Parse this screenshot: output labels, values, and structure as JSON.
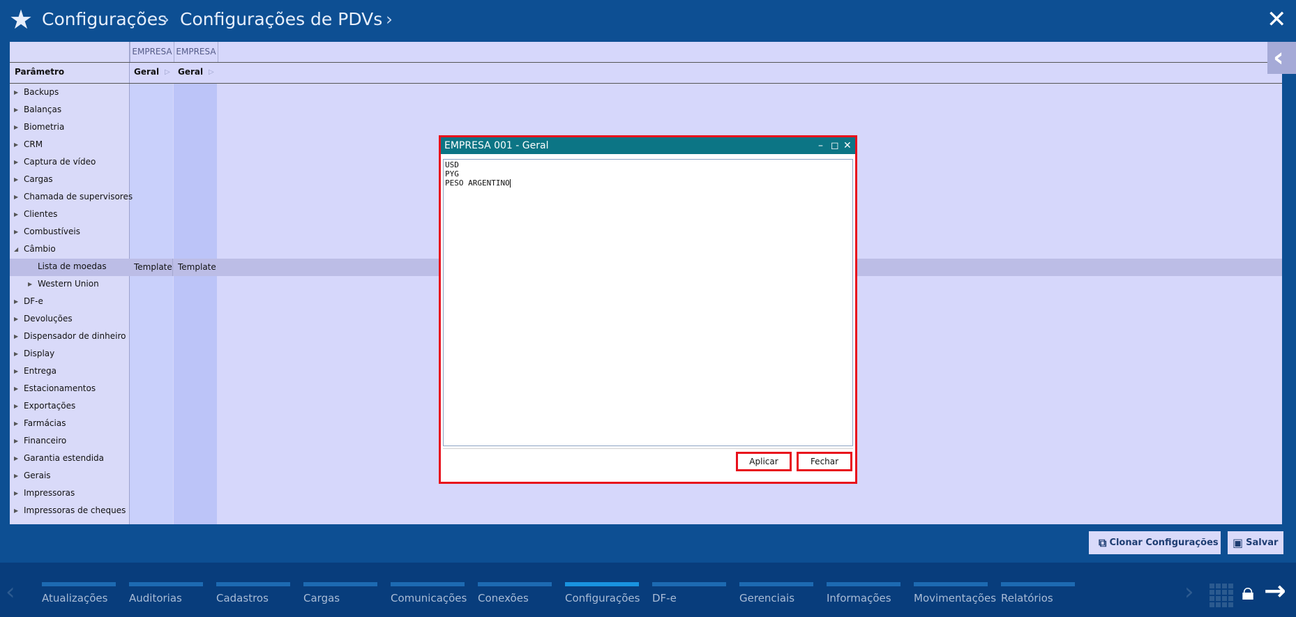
{
  "header": {
    "breadcrumb_1": "Configurações",
    "breadcrumb_2": "Configurações de PDVs"
  },
  "grid": {
    "column_group_1": "EMPRESA",
    "column_group_2": "EMPRESA",
    "param_header": "Parâmetro",
    "col_1_label": "Geral",
    "col_2_label": "Geral",
    "selected_row_values": [
      "Template",
      "Template"
    ]
  },
  "tree": [
    {
      "label": "Backups",
      "level": 0,
      "expanded": false
    },
    {
      "label": "Balanças",
      "level": 0,
      "expanded": false
    },
    {
      "label": "Biometria",
      "level": 0,
      "expanded": false
    },
    {
      "label": "CRM",
      "level": 0,
      "expanded": false
    },
    {
      "label": "Captura de vídeo",
      "level": 0,
      "expanded": false
    },
    {
      "label": "Cargas",
      "level": 0,
      "expanded": false
    },
    {
      "label": "Chamada de supervisores",
      "level": 0,
      "expanded": false
    },
    {
      "label": "Clientes",
      "level": 0,
      "expanded": false
    },
    {
      "label": "Combustíveis",
      "level": 0,
      "expanded": false
    },
    {
      "label": "Câmbio",
      "level": 0,
      "expanded": true
    },
    {
      "label": "Lista de moedas",
      "level": 1,
      "leaf": true
    },
    {
      "label": "Western Union",
      "level": 1,
      "expanded": false
    },
    {
      "label": "DF-e",
      "level": 0,
      "expanded": false
    },
    {
      "label": "Devoluções",
      "level": 0,
      "expanded": false
    },
    {
      "label": "Dispensador de dinheiro",
      "level": 0,
      "expanded": false
    },
    {
      "label": "Display",
      "level": 0,
      "expanded": false
    },
    {
      "label": "Entrega",
      "level": 0,
      "expanded": false
    },
    {
      "label": "Estacionamentos",
      "level": 0,
      "expanded": false
    },
    {
      "label": "Exportações",
      "level": 0,
      "expanded": false
    },
    {
      "label": "Farmácias",
      "level": 0,
      "expanded": false
    },
    {
      "label": "Financeiro",
      "level": 0,
      "expanded": false
    },
    {
      "label": "Garantia estendida",
      "level": 0,
      "expanded": false
    },
    {
      "label": "Gerais",
      "level": 0,
      "expanded": false
    },
    {
      "label": "Impressoras",
      "level": 0,
      "expanded": false
    },
    {
      "label": "Impressoras de cheques",
      "level": 0,
      "expanded": false
    }
  ],
  "dialog": {
    "title": "EMPRESA 001 - Geral",
    "lines": [
      "USD",
      "PYG",
      "PESO ARGENTINO"
    ],
    "apply_label": "Aplicar",
    "close_label": "Fechar"
  },
  "actions": {
    "clone_label": "Clonar Configurações",
    "save_label": "Salvar"
  },
  "bottom_nav": {
    "active": "Configurações",
    "items": [
      "Atualizações",
      "Auditorias",
      "Cadastros",
      "Cargas",
      "Comunicações",
      "Conexões",
      "Configurações",
      "DF-e",
      "Gerenciais",
      "Informações",
      "Movimentações",
      "Relatórios"
    ]
  },
  "colors": {
    "background": "#0d4f93",
    "panel": "#d6d7fb",
    "dialog_title": "#0c7585",
    "highlight_border": "#e8101c",
    "nav_active": "#1993e0"
  }
}
